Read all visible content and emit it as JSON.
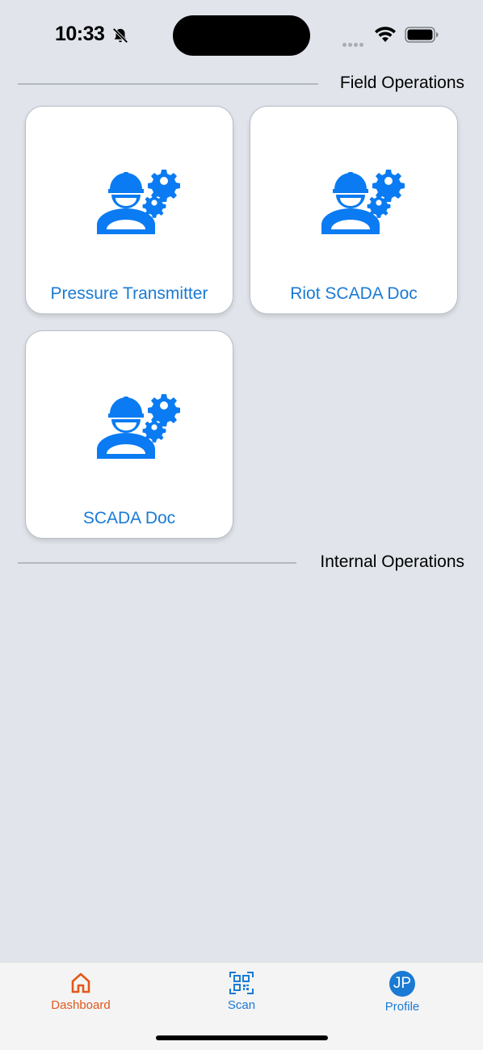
{
  "status_bar": {
    "time": "10:33",
    "icons": [
      "bell-slash-icon",
      "signal-icon",
      "wifi-icon",
      "battery-icon"
    ]
  },
  "sections": {
    "field_operations": {
      "title": "Field Operations",
      "tiles": [
        {
          "label": "Pressure Transmitter",
          "icon": "worker-gears-icon"
        },
        {
          "label": "Riot SCADA Doc",
          "icon": "worker-gears-icon"
        },
        {
          "label": "SCADA Doc",
          "icon": "worker-gears-icon"
        }
      ]
    },
    "internal_operations": {
      "title": "Internal Operations"
    }
  },
  "tab_bar": {
    "tabs": [
      {
        "label": "Dashboard",
        "icon": "home-icon",
        "active": true
      },
      {
        "label": "Scan",
        "icon": "qr-scan-icon",
        "active": false
      },
      {
        "label": "Profile",
        "icon": "avatar",
        "initials": "JP",
        "active": false
      }
    ]
  },
  "colors": {
    "background": "#e1e5eb",
    "accent_blue": "#1a7ad4",
    "icon_blue": "#0a7bf2",
    "active_tab": "#e2581a"
  }
}
